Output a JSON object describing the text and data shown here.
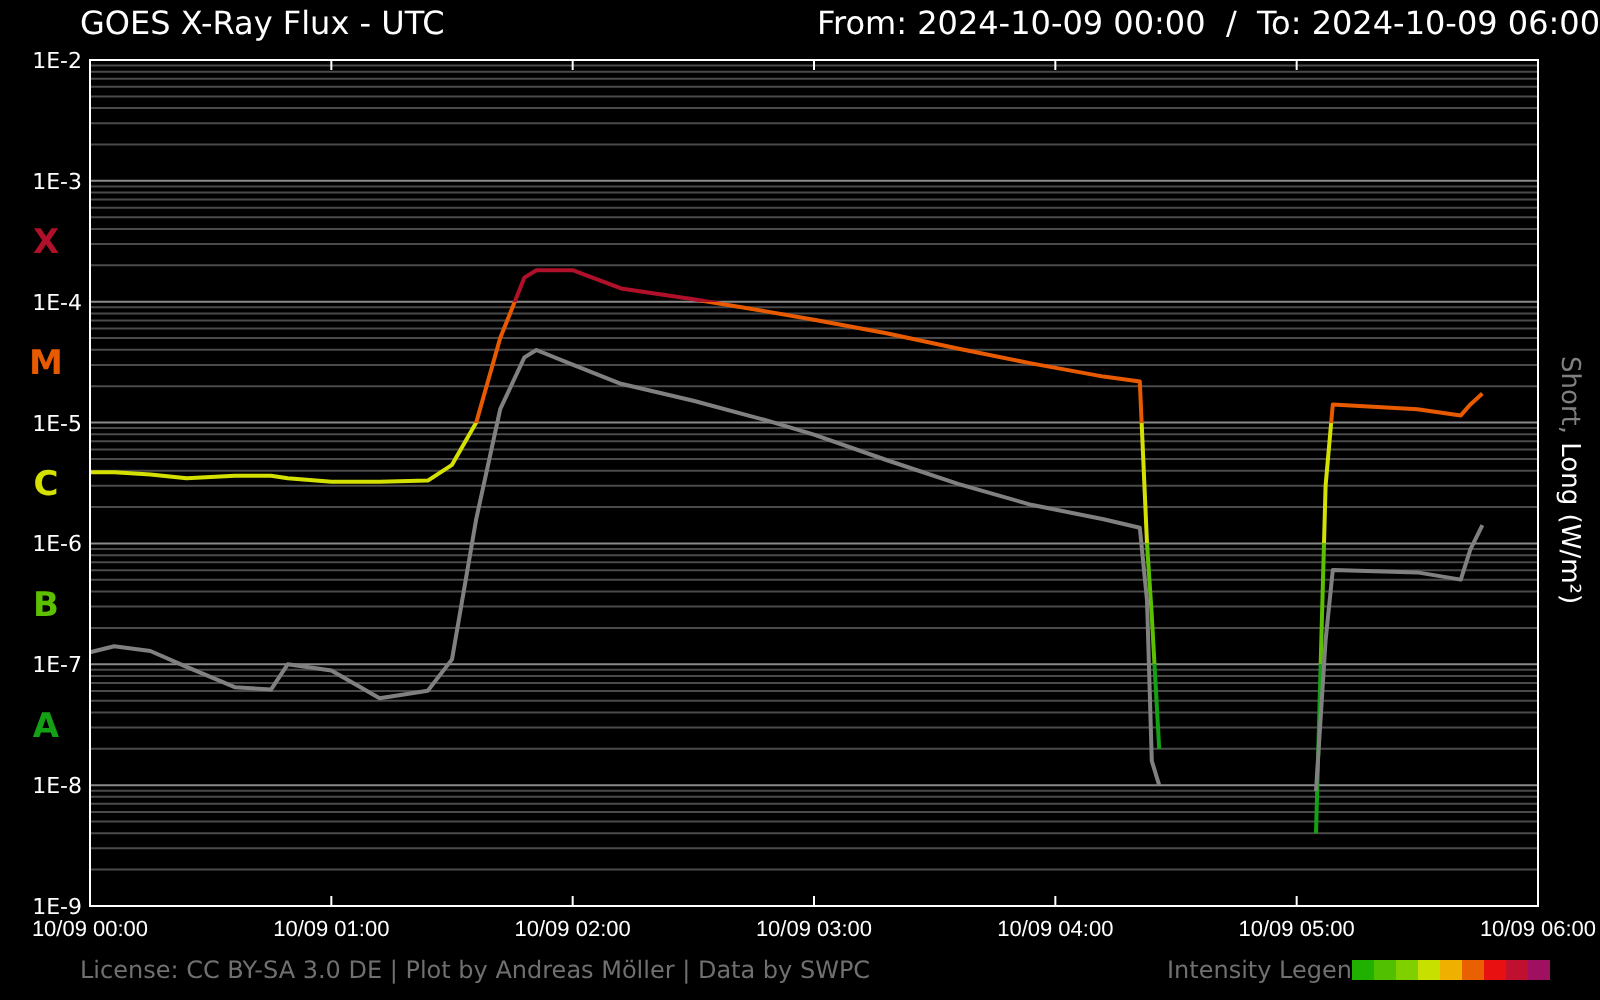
{
  "header": {
    "title": "GOES X-Ray Flux - UTC",
    "range": "From: 2024-10-09 00:00  /  To: 2024-10-09 06:00"
  },
  "plot": {
    "y_labels": [
      "1E-2",
      "1E-3",
      "1E-4",
      "1E-5",
      "1E-6",
      "1E-7",
      "1E-8",
      "1E-9"
    ],
    "x_labels": [
      "10/09 00:00",
      "10/09 01:00",
      "10/09 02:00",
      "10/09 03:00",
      "10/09 04:00",
      "10/09 05:00",
      "10/09 06:00"
    ],
    "classes": [
      {
        "text": "X",
        "color": "#b0102a"
      },
      {
        "text": "M",
        "color": "#e85a00"
      },
      {
        "text": "C",
        "color": "#d4e000"
      },
      {
        "text": "B",
        "color": "#5cbf00"
      },
      {
        "text": "A",
        "color": "#14a014"
      }
    ],
    "axis_label": [
      {
        "text": "Short,",
        "color": "#808080"
      },
      {
        "text": "Long (W/m²)",
        "color": "#ffffff"
      }
    ]
  },
  "footer": {
    "credits": "License: CC BY-SA 3.0 DE | Plot by Andreas Möller | Data by SWPC",
    "legend_label": "Intensity Legen",
    "legend_colors": [
      {
        "color": "#20b000"
      },
      {
        "color": "#50c000"
      },
      {
        "color": "#80d000"
      },
      {
        "color": "#c8e000"
      },
      {
        "color": "#f0b000"
      },
      {
        "color": "#e86000"
      },
      {
        "color": "#e81010"
      },
      {
        "color": "#c01030"
      },
      {
        "color": "#a01060"
      }
    ]
  }
}
